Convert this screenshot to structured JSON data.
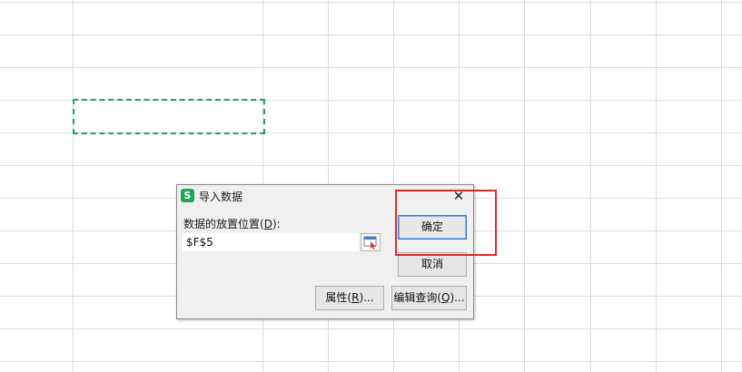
{
  "dialog": {
    "title": "导入数据",
    "app_logo_letter": "S",
    "close_glyph": "✕",
    "field_label_prefix": "数据的放置位置(",
    "field_label_accel": "D",
    "field_label_suffix": "):",
    "location_value": "$F$5",
    "buttons": {
      "ok": "确定",
      "cancel": "取消",
      "properties_prefix": "属性(",
      "properties_accel": "R",
      "properties_suffix": ")...",
      "edit_query_prefix": "编辑查询(",
      "edit_query_accel": "Q",
      "edit_query_suffix": ")..."
    },
    "icons": {
      "app": "wps-spreadsheet-logo-icon",
      "close": "close-icon",
      "picker": "range-picker-icon"
    }
  },
  "colors": {
    "selection_border": "#21a366",
    "highlight_border": "#e02a2a",
    "default_button_border": "#2f7bd8",
    "app_logo": "#22a45a",
    "grid_line": "#d8dbe0"
  }
}
